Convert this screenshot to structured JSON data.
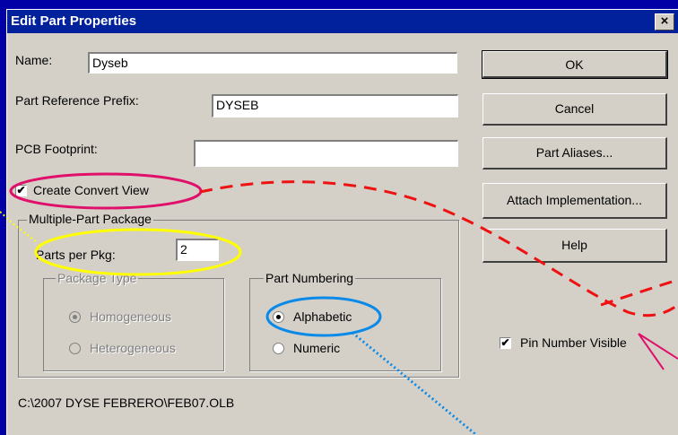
{
  "window": {
    "title": "Edit Part Properties",
    "close_label": "×"
  },
  "fields": {
    "name": {
      "label": "Name:",
      "value": "Dyseb"
    },
    "prefix": {
      "label": "Part Reference Prefix:",
      "value": "DYSEB"
    },
    "footprint": {
      "label": "PCB Footprint:",
      "value": ""
    }
  },
  "buttons": {
    "ok": "OK",
    "cancel": "Cancel",
    "aliases": "Part Aliases...",
    "attach": "Attach Implementation...",
    "help": "Help"
  },
  "convert_view": {
    "label": "Create Convert View",
    "checked": true
  },
  "package": {
    "legend": "Multiple-Part Package",
    "parts_label": "Parts per Pkg:",
    "parts_value": "2",
    "type": {
      "legend": "Package Type",
      "options": [
        {
          "label": "Homogeneous",
          "selected": true,
          "enabled": false
        },
        {
          "label": "Heterogeneous",
          "selected": false,
          "enabled": false
        }
      ]
    },
    "numbering": {
      "legend": "Part Numbering",
      "options": [
        {
          "label": "Alphabetic",
          "selected": true,
          "enabled": true
        },
        {
          "label": "Numeric",
          "selected": false,
          "enabled": true
        }
      ]
    }
  },
  "pin_number": {
    "label": "Pin Number Visible",
    "checked": true
  },
  "path": "C:\\2007 DYSE FEBRERO\\FEB07.OLB",
  "annotation_colors": {
    "magenta": "#e0106a",
    "yellow": "#ffff00",
    "blue": "#0a8ae8",
    "red": "#ee1111",
    "dialog": "#d4d0c8",
    "titlebar": "#00209c"
  }
}
